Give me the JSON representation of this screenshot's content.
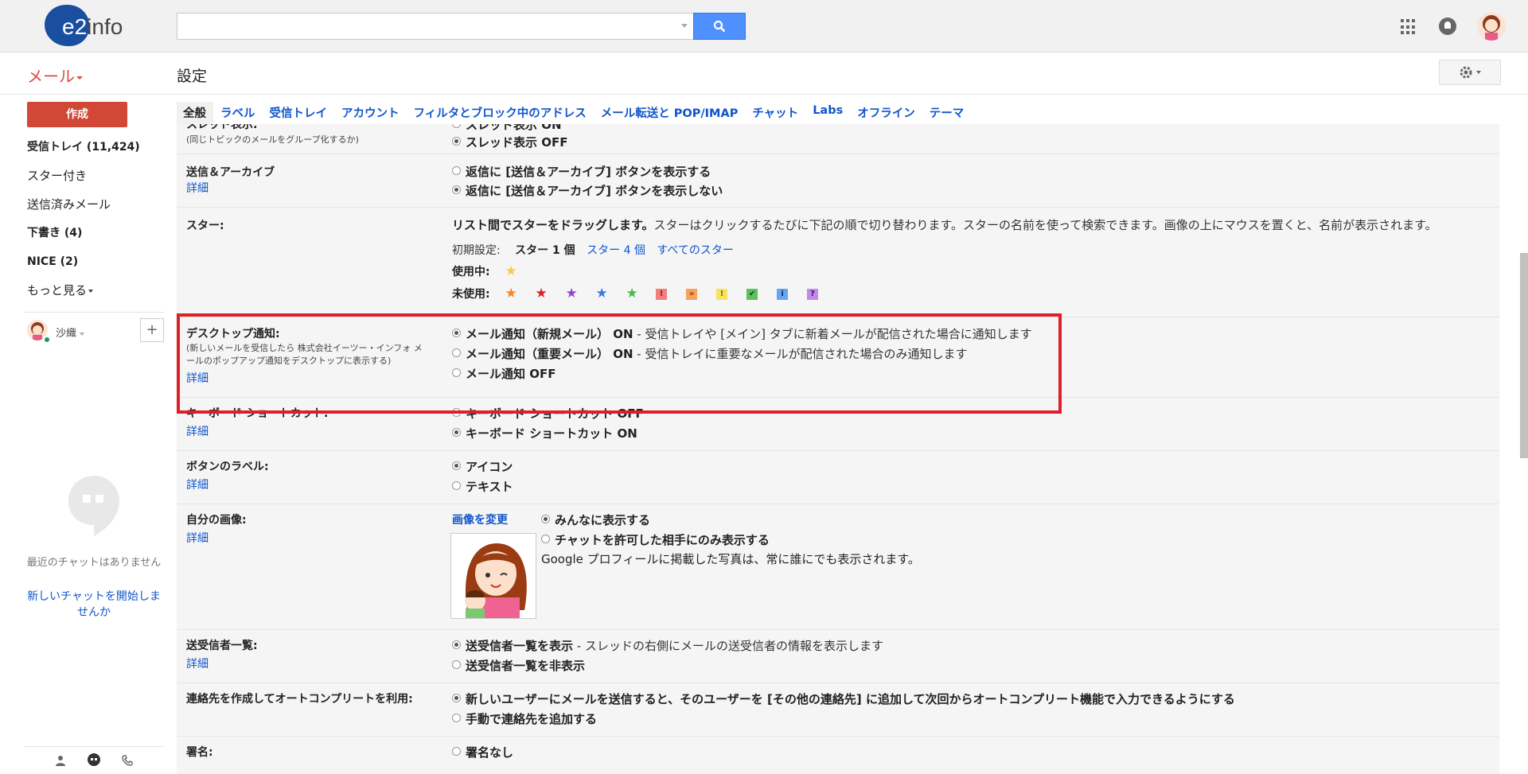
{
  "header": {
    "logo_e2": "e2",
    "logo_info": "info",
    "search_placeholder": "",
    "mail_label": "メール",
    "page_title": "設定"
  },
  "sidebar": {
    "compose_label": "作成",
    "items": [
      {
        "label": "受信トレイ (11,424)",
        "bold": true
      },
      {
        "label": "スター付き",
        "bold": false
      },
      {
        "label": "送信済みメール",
        "bold": false
      },
      {
        "label": "下書き (4)",
        "bold": true
      },
      {
        "label": "NICE (2)",
        "bold": true
      },
      {
        "label": "もっと見る",
        "bold": false
      }
    ],
    "user_name": "沙織",
    "plus_label": "+",
    "chat_empty": "最近のチャットはありません",
    "chat_start": "新しいチャットを開始しませんか"
  },
  "tabs": [
    "全般",
    "ラベル",
    "受信トレイ",
    "アカウント",
    "フィルタとブロック中のアドレス",
    "メール転送と POP/IMAP",
    "チャット",
    "Labs",
    "オフライン",
    "テーマ"
  ],
  "settings": {
    "thread": {
      "label": "スレッド表示:",
      "sub": "(同じトピックのメールをグループ化するか)",
      "opt1": "スレッド表示 ON",
      "opt2": "スレッド表示 OFF"
    },
    "send_archive": {
      "label": "送信＆アーカイブ",
      "detail": "詳細",
      "opt1": "返信に [送信＆アーカイブ] ボタンを表示する",
      "opt2": "返信に [送信＆アーカイブ] ボタンを表示しない"
    },
    "stars": {
      "label": "スター:",
      "desc_bold": "リスト間でスターをドラッグします。",
      "desc": "スターはクリックするたびに下記の順で切り替わります。スターの名前を使って検索できます。画像の上にマウスを置くと、名前が表示されます。",
      "preset_label": "初期設定:",
      "preset_1": "スター 1 個",
      "preset_4": "スター 4 個",
      "preset_all": "すべてのスター",
      "in_use": "使用中:",
      "not_in_use": "未使用:",
      "sq_red": "!",
      "sq_orange": "»",
      "sq_yellow": "!",
      "sq_green": "✔",
      "sq_blue": "i",
      "sq_purple": "?"
    },
    "desktop": {
      "label": "デスクトップ通知:",
      "sub1": "(新しいメールを受信したら 株式会社イーツー・インフォ メ",
      "sub2": "ールのポップアップ通知をデスクトップに表示する)",
      "detail": "詳細",
      "opt1": "メール通知（新規メール） ON",
      "opt1_desc": " - 受信トレイや [メイン] タブに新着メールが配信された場合に通知します",
      "opt2": "メール通知（重要メール） ON",
      "opt2_desc": " - 受信トレイに重要なメールが配信された場合のみ通知します",
      "opt3": "メール通知 OFF"
    },
    "keyboard": {
      "label": "キーボード ショートカット:",
      "detail": "詳細",
      "opt1": "キーボード ショートカット OFF",
      "opt2": "キーボード ショートカット ON"
    },
    "button_labels": {
      "label": "ボタンのラベル:",
      "detail": "詳細",
      "opt1": "アイコン",
      "opt2": "テキスト"
    },
    "my_picture": {
      "label": "自分の画像:",
      "detail": "詳細",
      "change": "画像を変更",
      "opt1": "みんなに表示する",
      "opt2": "チャットを許可した相手にのみ表示する",
      "note": "Google プロフィールに掲載した写真は、常に誰にでも表示されます。"
    },
    "senders": {
      "label": "送受信者一覧:",
      "detail": "詳細",
      "opt1": "送受信者一覧を表示",
      "opt1_desc": " - スレッドの右側にメールの送受信者の情報を表示します",
      "opt2": "送受信者一覧を非表示"
    },
    "autocomplete": {
      "label": "連絡先を作成してオートコンプリートを利用:",
      "opt1": "新しいユーザーにメールを送信すると、そのユーザーを [その他の連絡先] に追加して次回からオートコンプリート機能で入力できるようにする",
      "opt2": "手動で連絡先を追加する"
    },
    "signature": {
      "label": "署名:",
      "opt1": "署名なし"
    }
  },
  "colors": {
    "accent_red": "#dd4b39",
    "compose_bg": "#d14836",
    "link_blue": "#1155cc",
    "highlight_border": "#dd1f2a",
    "search_blue": "#4d90fe"
  }
}
